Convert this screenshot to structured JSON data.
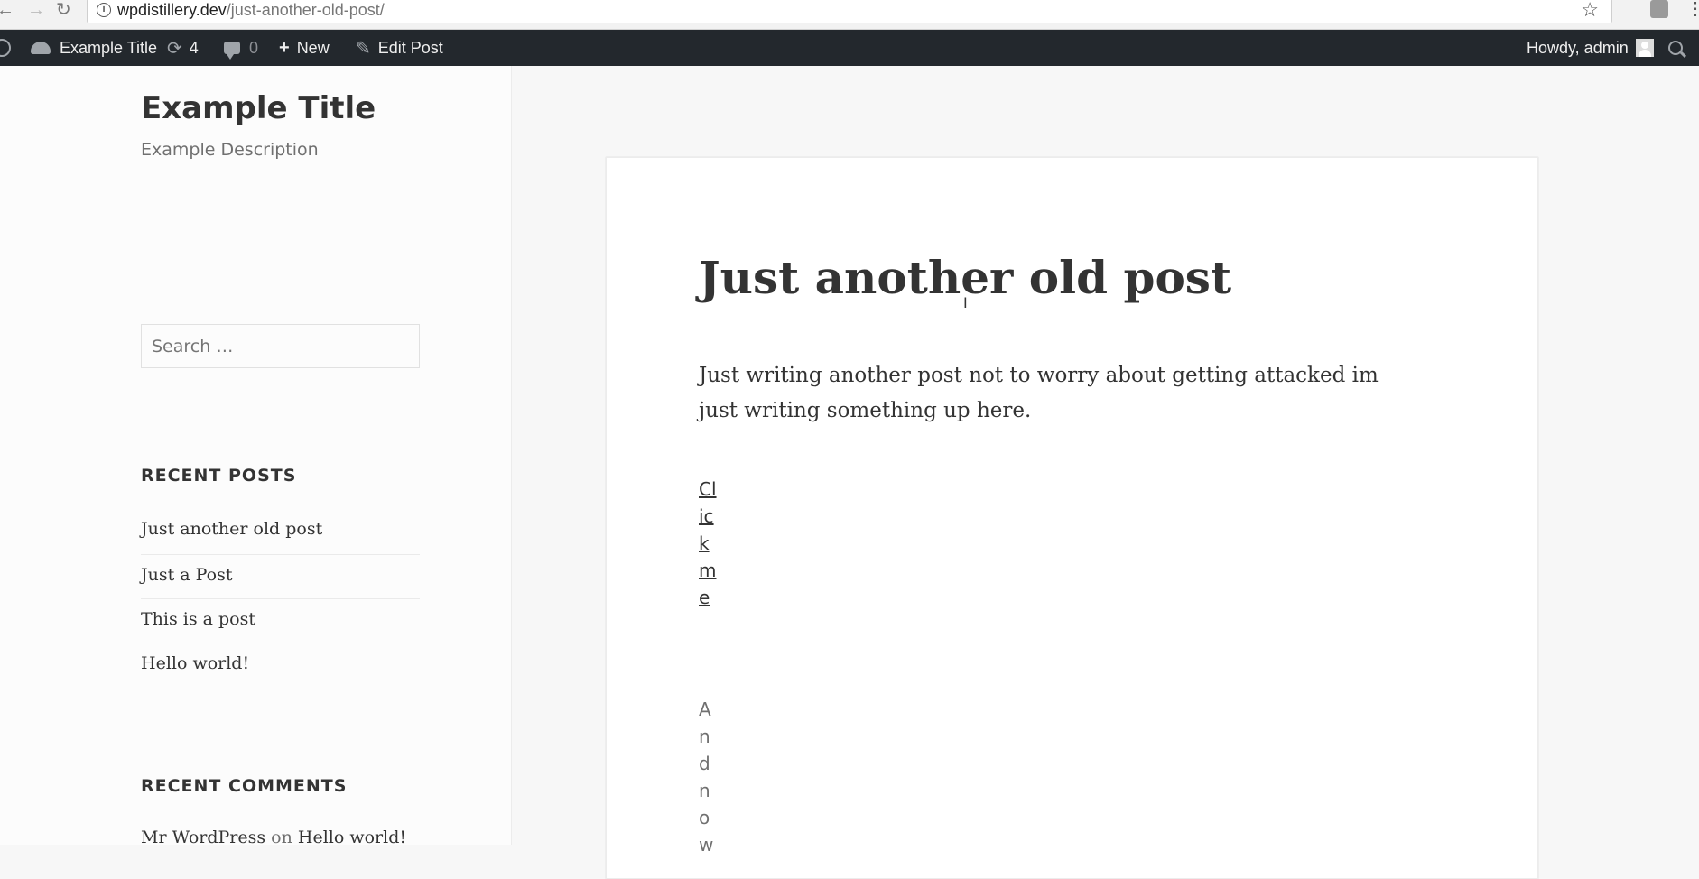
{
  "browser": {
    "back_icon": "arrow-left-icon",
    "forward_icon": "arrow-right-icon",
    "reload_icon": "reload-icon",
    "url_domain": "wpdistillery.dev",
    "url_path": "/just-another-old-post/"
  },
  "admin_bar": {
    "site_name": "Example Title",
    "updates_count": "4",
    "comments_count": "0",
    "new_label": "New",
    "edit_label": "Edit Post",
    "howdy": "Howdy, admin"
  },
  "sidebar": {
    "site_title": "Example Title",
    "site_description": "Example Description",
    "search_placeholder": "Search …",
    "recent_posts_title": "RECENT POSTS",
    "recent_posts": [
      "Just another old post",
      "Just a Post",
      "This is a post",
      "Hello world!"
    ],
    "recent_comments_title": "RECENT COMMENTS",
    "comment_author": "Mr WordPress",
    "comment_on": "on",
    "comment_post": "Hello world!"
  },
  "post": {
    "title": "Just another old post",
    "body": "Just writing another post not to worry about getting attacked im just writing something up here.",
    "link_text": "Clickme",
    "trailing_text": "Andnow"
  }
}
